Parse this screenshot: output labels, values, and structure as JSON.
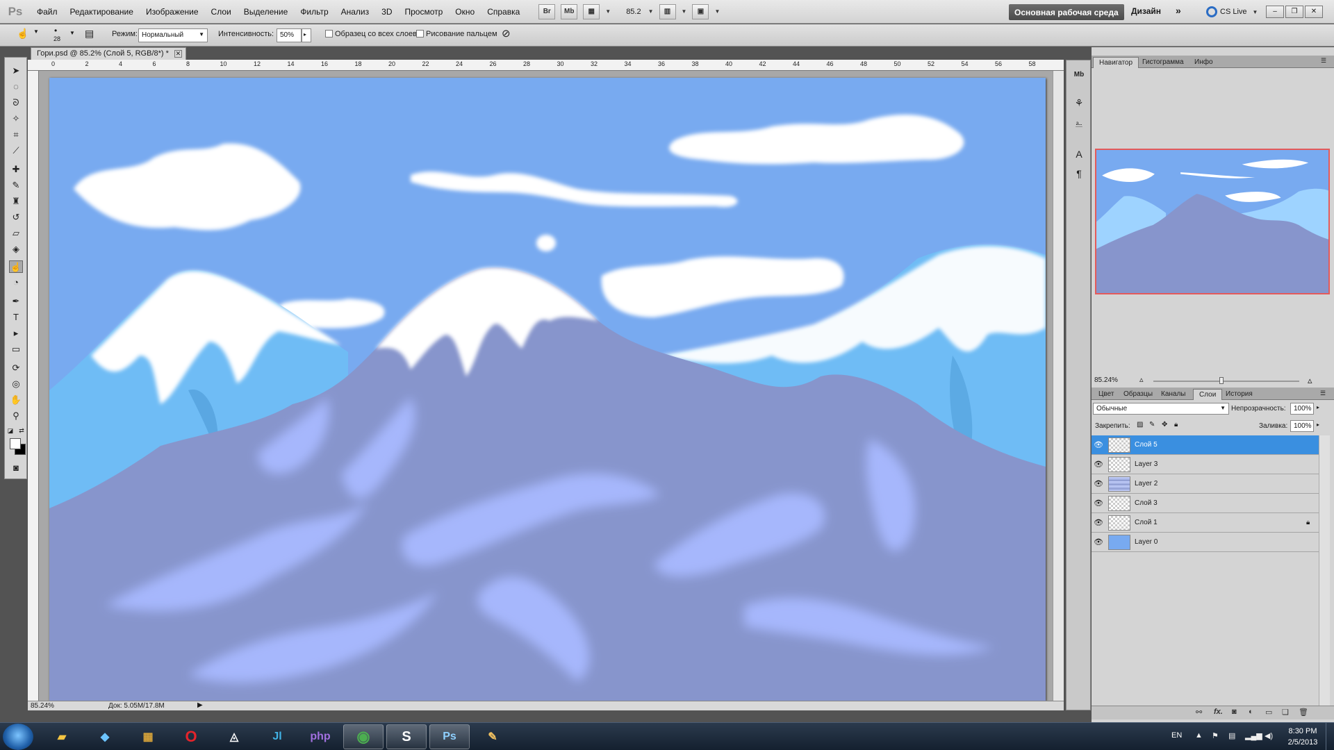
{
  "app": {
    "logo": "Ps"
  },
  "menu": [
    "Файл",
    "Редактирование",
    "Изображение",
    "Слои",
    "Выделение",
    "Фильтр",
    "Анализ",
    "3D",
    "Просмотр",
    "Окно",
    "Справка"
  ],
  "menubar_tools": {
    "bridge": "Br",
    "minibridge": "Mb",
    "zoom": "85.2"
  },
  "workspace": {
    "active": "Основная рабочая среда",
    "design": "Дизайн",
    "more": "»",
    "cslive": "CS Live"
  },
  "window_buttons": [
    "–",
    "❐",
    "✕"
  ],
  "options": {
    "brush_size": "28",
    "mode_label": "Режим:",
    "mode_value": "Нормальный",
    "intensity_label": "Интенсивность:",
    "intensity_value": "50%",
    "sample_all": "Образец со всех слоев",
    "finger_paint": "Рисование пальцем"
  },
  "document": {
    "tab_title": "Гори.psd @ 85.2% (Слой 5, RGB/8*) *",
    "zoom": "85.24%",
    "doc_info": "Док: 5.05M/17.8M"
  },
  "ruler": {
    "ticks": [
      "0",
      "2",
      "4",
      "6",
      "8",
      "10",
      "12",
      "14",
      "16",
      "18",
      "20",
      "22",
      "24",
      "26",
      "28",
      "30",
      "32",
      "34",
      "36",
      "38",
      "40",
      "42",
      "44",
      "46",
      "48",
      "50",
      "52",
      "54",
      "56",
      "58"
    ]
  },
  "navigator": {
    "tabs": [
      "Навигатор",
      "Гистограмма",
      "Инфо"
    ],
    "zoom": "85.24%"
  },
  "layers_panel": {
    "tabs": [
      "Цвет",
      "Образцы",
      "Каналы",
      "Слои",
      "История"
    ],
    "blend_mode": "Обычные",
    "opacity_label": "Непрозрачность:",
    "opacity_value": "100%",
    "lock_label": "Закрепить:",
    "fill_label": "Заливка:",
    "fill_value": "100%",
    "layers": [
      {
        "name": "Слой 5",
        "selected": true,
        "locked": false
      },
      {
        "name": "Layer 3",
        "selected": false,
        "locked": false
      },
      {
        "name": "Layer 2",
        "selected": false,
        "locked": false
      },
      {
        "name": "Слой 3",
        "selected": false,
        "locked": false
      },
      {
        "name": "Слой 1",
        "selected": false,
        "locked": true
      },
      {
        "name": "Layer 0",
        "selected": false,
        "locked": false
      }
    ]
  },
  "taskbar": {
    "apps": [
      "explorer",
      "nfo-viewer",
      "winrar",
      "opera",
      "foobar",
      "jetbrains",
      "php-storm",
      "chrome",
      "skype",
      "photoshop",
      "paint"
    ],
    "ps_label": "Ps",
    "lang": "EN",
    "time": "8:30 PM",
    "date": "2/5/2013"
  },
  "colors": {
    "sky": "#78aaf0",
    "mountain": "#8795cc",
    "snow": "#ffffff",
    "selection": "#3a8fe0"
  }
}
